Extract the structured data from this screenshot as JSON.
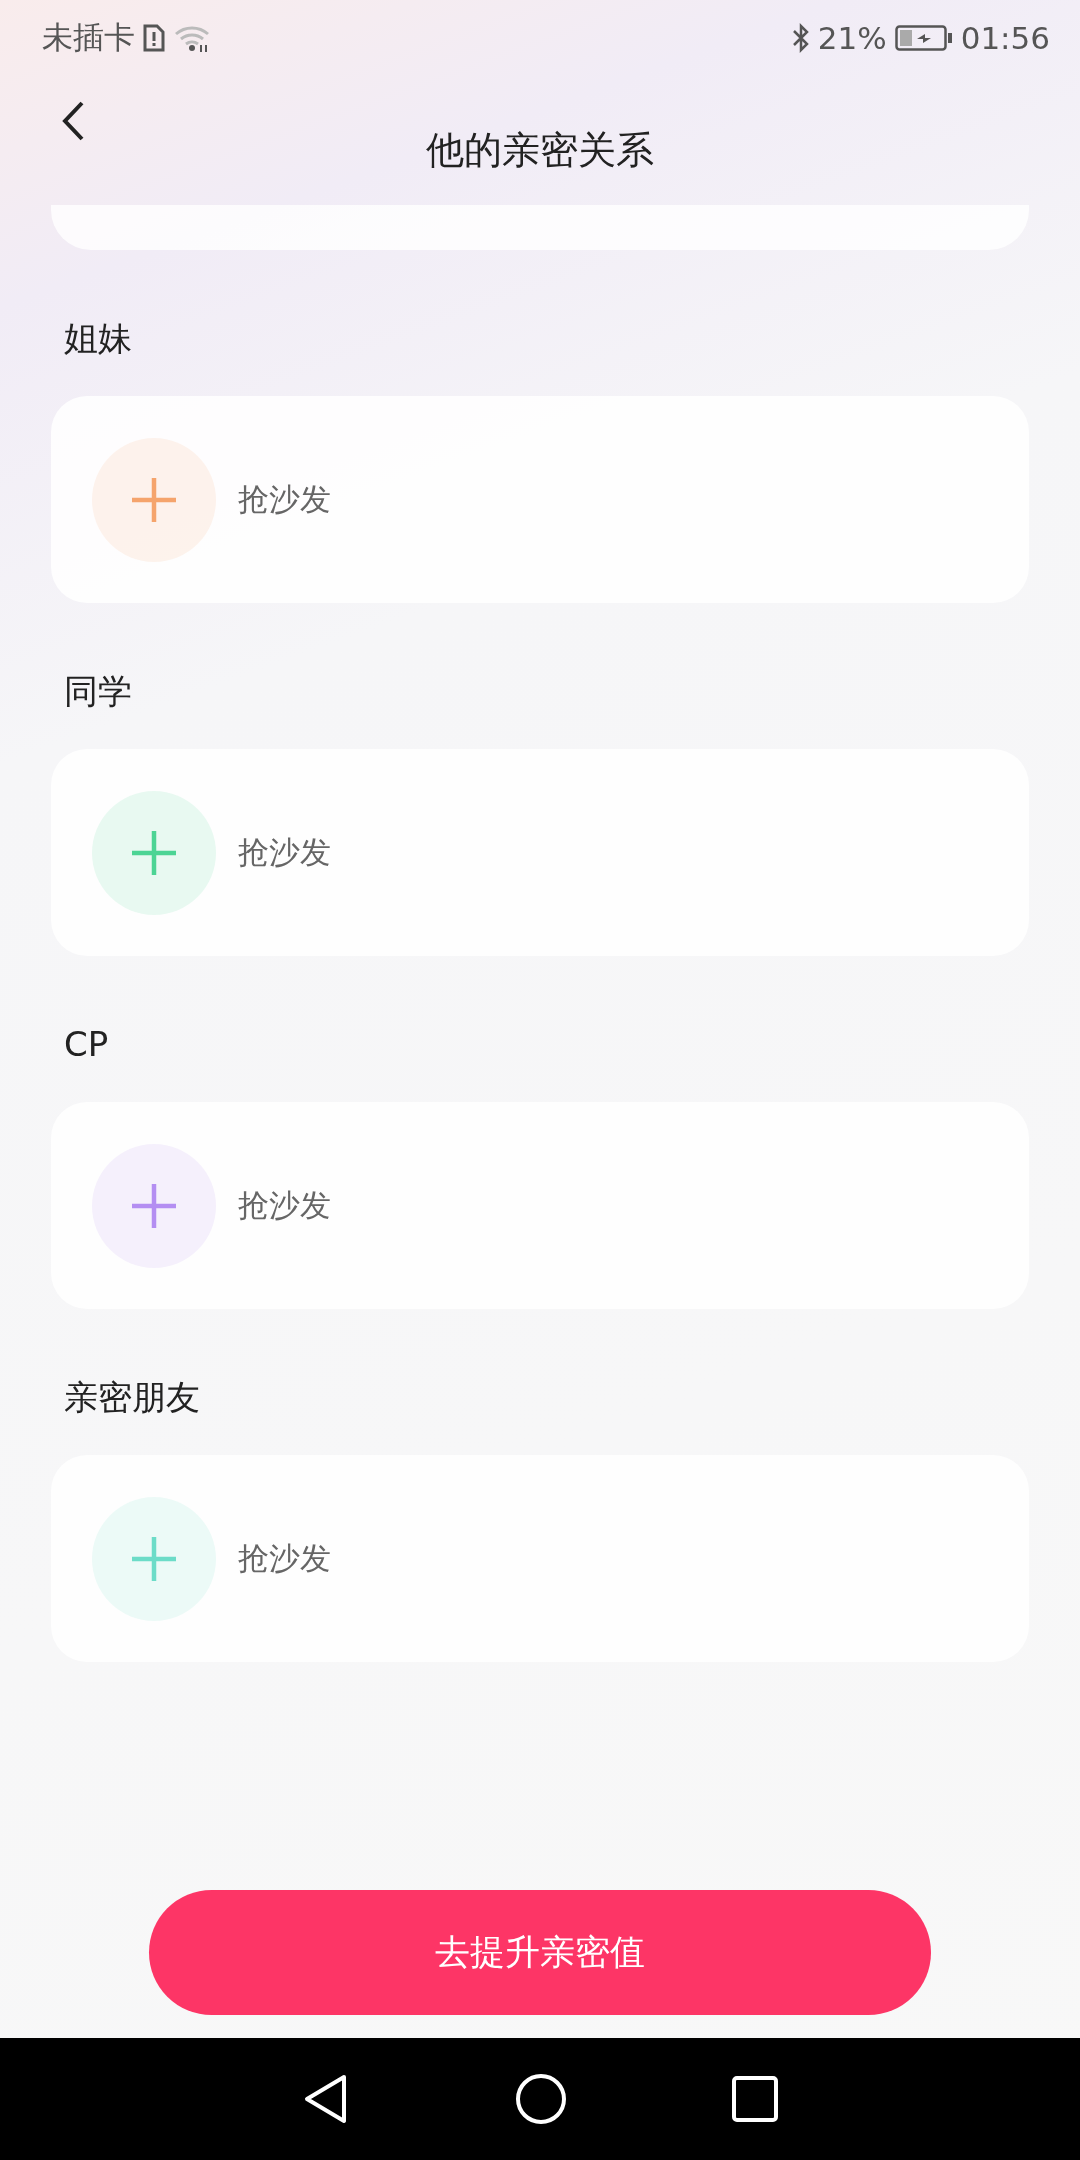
{
  "status_bar": {
    "carrier": "未插卡",
    "battery": "21%",
    "time": "01:56"
  },
  "header": {
    "title": "他的亲密关系"
  },
  "sections": [
    {
      "title": "姐妹",
      "action": "抢沙发",
      "color": "#f5a46c"
    },
    {
      "title": "同学",
      "action": "抢沙发",
      "color": "#4cd494"
    },
    {
      "title": "CP",
      "action": "抢沙发",
      "color": "#b48ef2"
    },
    {
      "title": "亲密朋友",
      "action": "抢沙发",
      "color": "#6cdcc8"
    }
  ],
  "primary_button": {
    "label": "去提升亲密值"
  }
}
